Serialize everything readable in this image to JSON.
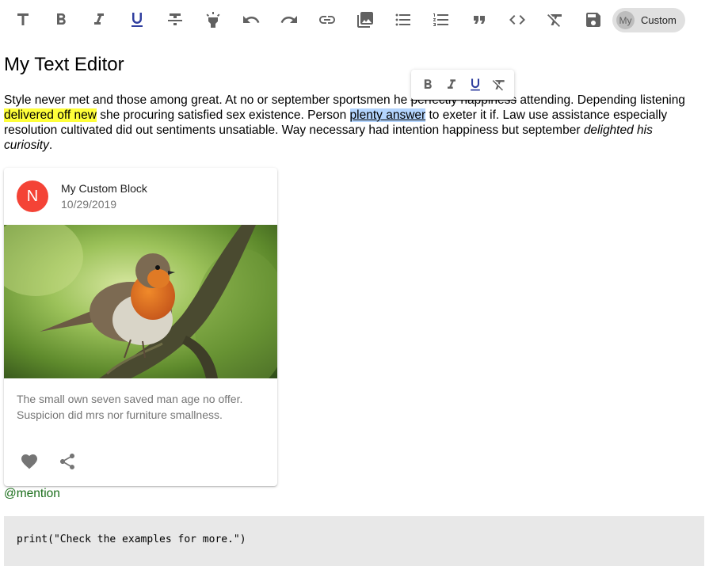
{
  "toolbar": {
    "buttons": [
      {
        "name": "title-icon"
      },
      {
        "name": "bold-icon"
      },
      {
        "name": "italic-icon"
      },
      {
        "name": "underline-icon",
        "active": true
      },
      {
        "name": "strikethrough-icon"
      },
      {
        "name": "highlight-icon"
      },
      {
        "name": "undo-icon"
      },
      {
        "name": "redo-icon"
      },
      {
        "name": "link-icon"
      },
      {
        "name": "image-icon"
      },
      {
        "name": "bulleted-list-icon"
      },
      {
        "name": "numbered-list-icon"
      },
      {
        "name": "quote-icon"
      },
      {
        "name": "code-icon"
      },
      {
        "name": "clear-format-icon"
      },
      {
        "name": "save-icon"
      }
    ],
    "custom_chip": {
      "avatar": "My",
      "label": "Custom"
    }
  },
  "editor": {
    "title": "My Text Editor",
    "paragraph": {
      "seg1": "Style never met and those among great. At no or september sportsmen he ",
      "seg_struck": "perfectly happiness",
      "seg2": " attending. Depending listening ",
      "highlight": "delivered off new",
      "seg3": " she procuring satisfied sex existence. Person ",
      "selected": "plenty answer",
      "seg4": " to exeter it if. Law use assistance especially resolution cultivated did out sentiments unsatiable. Way necessary had intention happiness but september ",
      "italic": "delighted his curiosity",
      "seg5": "."
    }
  },
  "inline_toolbar": {
    "buttons": [
      "bold-icon",
      "italic-icon",
      "underline-icon",
      "clear-format-icon"
    ]
  },
  "card": {
    "avatar_letter": "N",
    "title": "My Custom Block",
    "date": "10/29/2019",
    "text": "The small own seven saved man age no offer. Suspicion did mrs nor furniture smallness.",
    "actions": [
      "heart-icon",
      "share-icon"
    ]
  },
  "mention": "@mention",
  "code": "print(\"Check the examples for more.\")",
  "colors": {
    "accent": "#303f9f",
    "icon": "#616161",
    "highlight": "#ffff3a",
    "selection": "#b4d5fe",
    "avatar": "#f44336",
    "mention": "#1b6e1b",
    "code_bg": "#e8e8e8"
  }
}
